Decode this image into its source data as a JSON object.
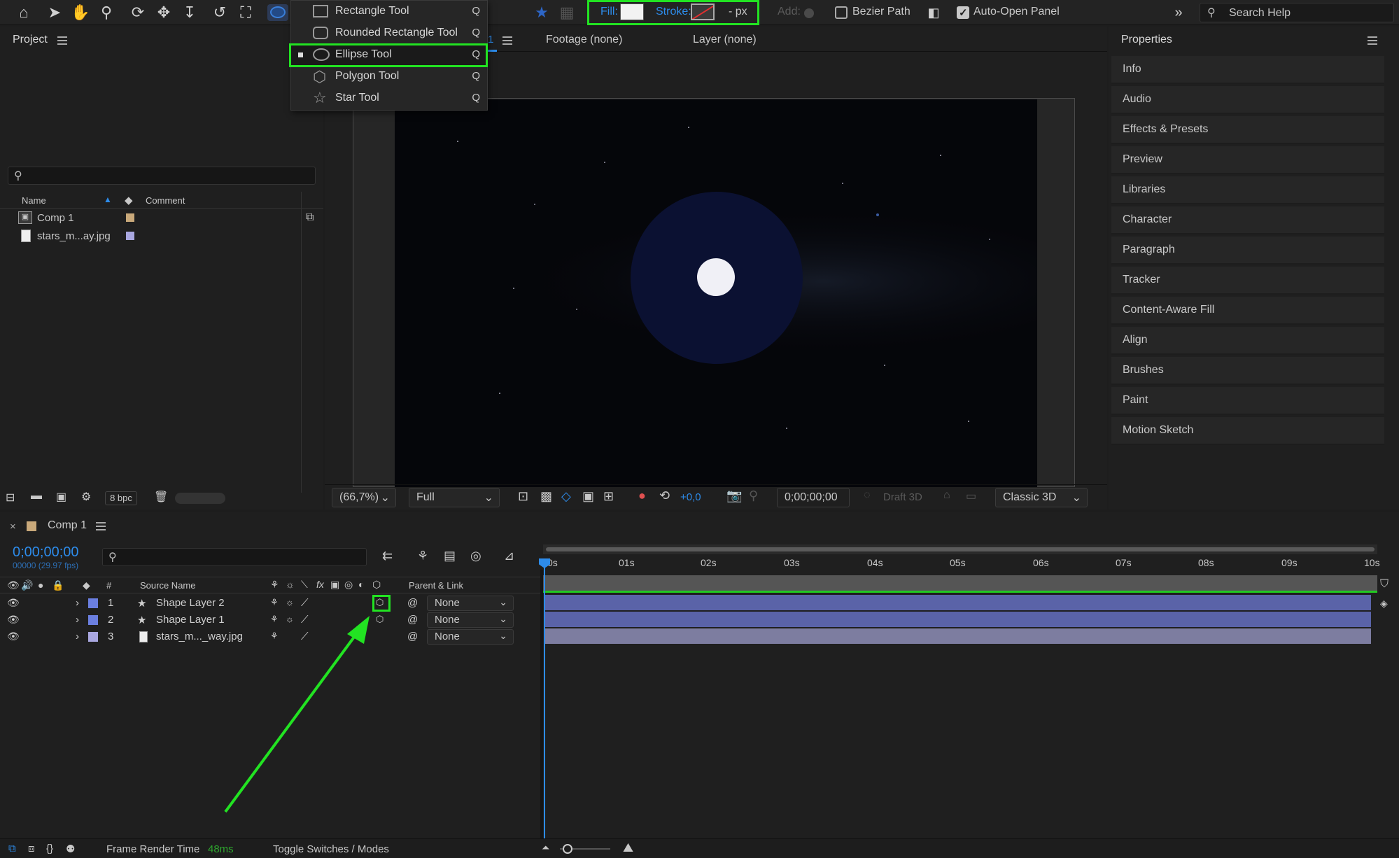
{
  "toolbar": {
    "fill_label": "Fill:",
    "stroke_label": "Stroke:",
    "stroke_unit": "- px",
    "add_label": "Add:",
    "bezier_path_label": "Bezier Path",
    "bezier_path_checked": false,
    "auto_open_panel_label": "Auto-Open Panel",
    "auto_open_panel_checked": true,
    "search_placeholder": "Search Help",
    "fill_color": "#f2f2f2",
    "accent_color": "#2d8ceb",
    "highlight_color": "#22e322"
  },
  "shape_menu": {
    "items": [
      {
        "label": "Rectangle Tool",
        "key": "Q",
        "icon": "rectangle-icon",
        "selected": false
      },
      {
        "label": "Rounded Rectangle Tool",
        "key": "Q",
        "icon": "rounded-rectangle-icon",
        "selected": false
      },
      {
        "label": "Ellipse Tool",
        "key": "Q",
        "icon": "ellipse-icon",
        "selected": true
      },
      {
        "label": "Polygon Tool",
        "key": "Q",
        "icon": "polygon-icon",
        "selected": false
      },
      {
        "label": "Star Tool",
        "key": "Q",
        "icon": "star-icon",
        "selected": false
      }
    ]
  },
  "project": {
    "title": "Project",
    "columns": {
      "name": "Name",
      "comment": "Comment"
    },
    "items": [
      {
        "name": "Comp 1",
        "icon": "composition-icon",
        "label_color": "#c9a97a"
      },
      {
        "name": "stars_m...ay.jpg",
        "icon": "image-file-icon",
        "label_color": "#a9a7e0"
      }
    ],
    "bpc": "8 bpc"
  },
  "viewer": {
    "tab_comp_suffix": "1",
    "tab_footage": "Footage (none)",
    "tab_layer": "Layer (none)",
    "zoom": "(66,7%)",
    "resolution": "Full",
    "exposure": "+0,0",
    "timecode": "0;00;00;00",
    "draft3d": "Draft 3D",
    "renderer": "Classic 3D"
  },
  "properties": {
    "title": "Properties",
    "items": [
      "Info",
      "Audio",
      "Effects & Presets",
      "Preview",
      "Libraries",
      "Character",
      "Paragraph",
      "Tracker",
      "Content-Aware Fill",
      "Align",
      "Brushes",
      "Paint",
      "Motion Sketch"
    ]
  },
  "timeline": {
    "tab_label": "Comp 1",
    "close_label": "×",
    "timecode": "0;00;00;00",
    "frame_info": "00000 (29.97 fps)",
    "column_number": "#",
    "column_source": "Source Name",
    "column_parent": "Parent & Link",
    "ruler_labels": [
      "0s",
      "01s",
      "02s",
      "03s",
      "04s",
      "05s",
      "06s",
      "07s",
      "08s",
      "09s",
      "10s"
    ],
    "layers": [
      {
        "number": "1",
        "name": "Shape Layer 2",
        "type": "shape",
        "parent": "None",
        "label_color": "#6b7fe0",
        "bar_color": "#5a63a8"
      },
      {
        "number": "2",
        "name": "Shape Layer 1",
        "type": "shape",
        "parent": "None",
        "label_color": "#6b7fe0",
        "bar_color": "#5a63a8"
      },
      {
        "number": "3",
        "name": "stars_m..._way.jpg",
        "type": "footage",
        "parent": "None",
        "label_color": "#a9a7e0",
        "bar_color": "#7d7da0"
      }
    ]
  },
  "status_bar": {
    "frame_render_label": "Frame Render Time",
    "frame_render_value": "48ms",
    "toggle_label": "Toggle Switches / Modes"
  }
}
